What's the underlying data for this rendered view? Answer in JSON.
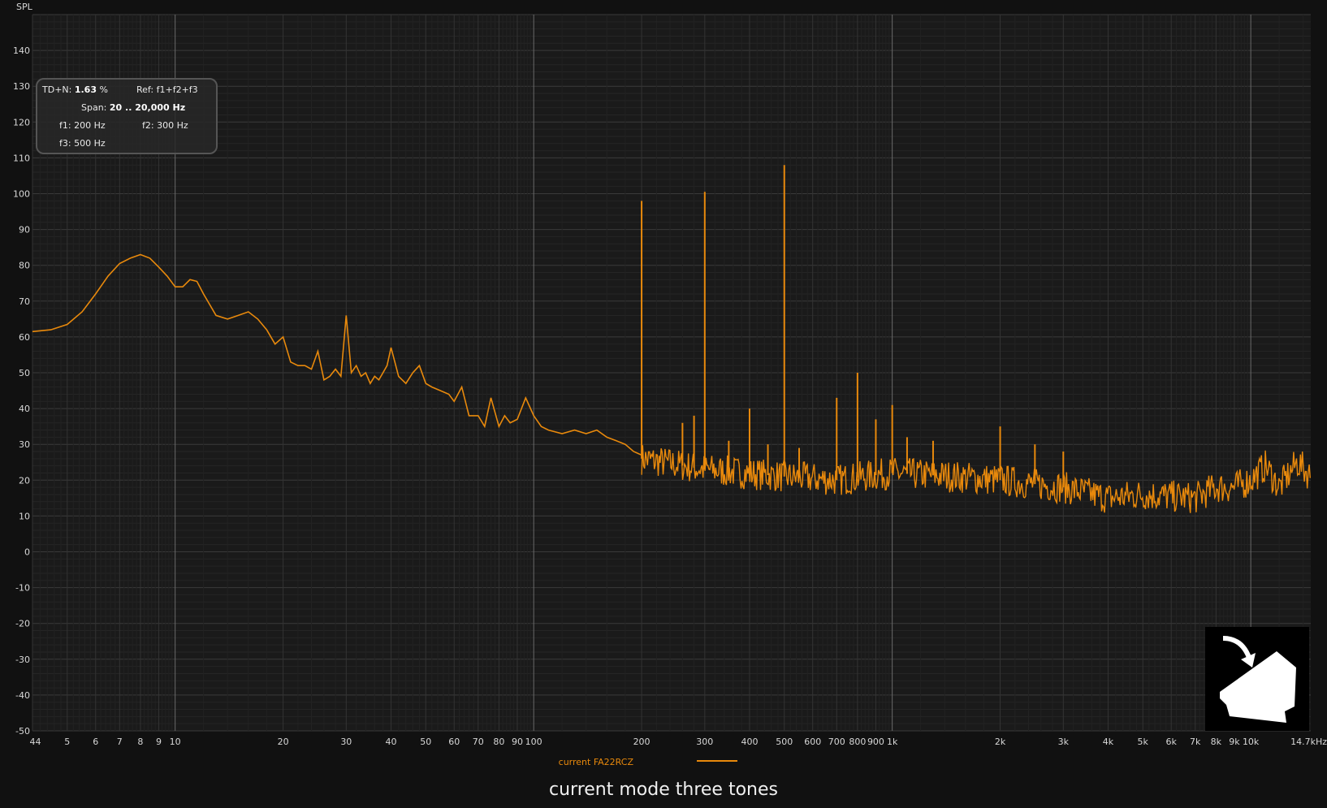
{
  "chart_data": {
    "type": "line",
    "ylabel": "SPL",
    "ylim": [
      -50,
      150
    ],
    "yticks": [
      -50,
      -40,
      -30,
      -20,
      -10,
      0,
      10,
      20,
      30,
      40,
      50,
      60,
      70,
      80,
      90,
      100,
      110,
      120,
      130,
      140
    ],
    "xscale": "log",
    "xlim": [
      4,
      14700
    ],
    "xticks": [
      {
        "value": 4,
        "label": "4"
      },
      {
        "value": 4.15,
        "label": "4"
      },
      {
        "value": 5,
        "label": "5"
      },
      {
        "value": 6,
        "label": "6"
      },
      {
        "value": 7,
        "label": "7"
      },
      {
        "value": 8,
        "label": "8"
      },
      {
        "value": 9,
        "label": "9"
      },
      {
        "value": 10,
        "label": "10"
      },
      {
        "value": 20,
        "label": "20"
      },
      {
        "value": 30,
        "label": "30"
      },
      {
        "value": 40,
        "label": "40"
      },
      {
        "value": 50,
        "label": "50"
      },
      {
        "value": 60,
        "label": "60"
      },
      {
        "value": 70,
        "label": "70"
      },
      {
        "value": 80,
        "label": "80"
      },
      {
        "value": 90,
        "label": "90"
      },
      {
        "value": 100,
        "label": "100"
      },
      {
        "value": 200,
        "label": "200"
      },
      {
        "value": 300,
        "label": "300"
      },
      {
        "value": 400,
        "label": "400"
      },
      {
        "value": 500,
        "label": "500"
      },
      {
        "value": 600,
        "label": "600"
      },
      {
        "value": 700,
        "label": "700"
      },
      {
        "value": 800,
        "label": "800"
      },
      {
        "value": 900,
        "label": "900"
      },
      {
        "value": 1000,
        "label": "1k"
      },
      {
        "value": 2000,
        "label": "2k"
      },
      {
        "value": 3000,
        "label": "3k"
      },
      {
        "value": 4000,
        "label": "4k"
      },
      {
        "value": 5000,
        "label": "5k"
      },
      {
        "value": 6000,
        "label": "6k"
      },
      {
        "value": 7000,
        "label": "7k"
      },
      {
        "value": 8000,
        "label": "8k"
      },
      {
        "value": 9000,
        "label": "9k"
      },
      {
        "value": 10000,
        "label": "10k"
      },
      {
        "value": 14700,
        "label": "14.7kHz"
      }
    ],
    "grid": true,
    "legend_position": "bottom-center",
    "series": [
      {
        "name": "current FA22RCZ",
        "color": "#e8890c",
        "x": [
          4,
          4.5,
          5,
          5.5,
          6,
          6.5,
          7,
          7.5,
          8,
          8.5,
          9,
          9.5,
          10,
          10.5,
          11,
          11.5,
          12,
          13,
          14,
          15,
          16,
          17,
          18,
          19,
          20,
          21,
          22,
          23,
          24,
          25,
          26,
          27,
          28,
          29,
          30,
          31,
          32,
          33,
          34,
          35,
          36,
          37,
          38,
          39,
          40,
          41,
          42,
          44,
          46,
          48,
          50,
          52,
          55,
          58,
          60,
          63,
          66,
          70,
          73,
          76,
          80,
          83,
          86,
          90,
          95,
          100,
          105,
          110,
          120,
          130,
          140,
          150,
          160,
          170,
          180,
          190,
          200
        ],
        "y": [
          61.5,
          62,
          63.5,
          67,
          72,
          77,
          80.5,
          82,
          83,
          82,
          79.5,
          77,
          74,
          74,
          76,
          75.5,
          72,
          66,
          65,
          66,
          67,
          65,
          62,
          58,
          60,
          53,
          52,
          52,
          51,
          56,
          48,
          49,
          51,
          49,
          66,
          50,
          52,
          49,
          50,
          47,
          49,
          48,
          50,
          52,
          57,
          53,
          49,
          47,
          50,
          52,
          47,
          46,
          45,
          44,
          42,
          46,
          38,
          38,
          35,
          43,
          35,
          38,
          36,
          37,
          43,
          38,
          35,
          34,
          33,
          34,
          33,
          34,
          32,
          31,
          30,
          28,
          27
        ]
      }
    ],
    "spikes": [
      {
        "x": 200,
        "y": 98
      },
      {
        "x": 260,
        "y": 36
      },
      {
        "x": 280,
        "y": 38
      },
      {
        "x": 300,
        "y": 100.5
      },
      {
        "x": 350,
        "y": 31
      },
      {
        "x": 400,
        "y": 40
      },
      {
        "x": 450,
        "y": 30
      },
      {
        "x": 500,
        "y": 108
      },
      {
        "x": 550,
        "y": 29
      },
      {
        "x": 700,
        "y": 43
      },
      {
        "x": 800,
        "y": 50
      },
      {
        "x": 900,
        "y": 37
      },
      {
        "x": 1000,
        "y": 41
      },
      {
        "x": 1100,
        "y": 32
      },
      {
        "x": 1300,
        "y": 31
      },
      {
        "x": 2000,
        "y": 35
      },
      {
        "x": 2500,
        "y": 30
      },
      {
        "x": 3000,
        "y": 28
      }
    ],
    "noise_floor": [
      {
        "x": 200,
        "y": 26
      },
      {
        "x": 300,
        "y": 23
      },
      {
        "x": 500,
        "y": 21
      },
      {
        "x": 700,
        "y": 20
      },
      {
        "x": 1000,
        "y": 22
      },
      {
        "x": 1500,
        "y": 21
      },
      {
        "x": 2000,
        "y": 20
      },
      {
        "x": 3000,
        "y": 18
      },
      {
        "x": 4000,
        "y": 15
      },
      {
        "x": 5000,
        "y": 16
      },
      {
        "x": 7000,
        "y": 15
      },
      {
        "x": 8000,
        "y": 18
      },
      {
        "x": 9000,
        "y": 18
      },
      {
        "x": 10000,
        "y": 20
      },
      {
        "x": 11000,
        "y": 24
      },
      {
        "x": 12000,
        "y": 18
      },
      {
        "x": 13500,
        "y": 25
      },
      {
        "x": 14700,
        "y": 21
      }
    ],
    "title": "current mode three tones"
  },
  "info_box": {
    "tdn_label": "TD+N:",
    "tdn_value": "1.63",
    "tdn_unit": "%",
    "ref_label": "Ref:",
    "ref_value": "f1+f2+f3",
    "span_label": "Span:",
    "span_value": "20 .. 20,000 Hz",
    "f1_label": "f1:",
    "f1_value": "200 Hz",
    "f2_label": "f2:",
    "f2_value": "300 Hz",
    "f3_label": "f3:",
    "f3_value": "500 Hz"
  },
  "colors": {
    "background": "#111111",
    "plot": "#1a1a1a",
    "trace": "#e8890c"
  }
}
